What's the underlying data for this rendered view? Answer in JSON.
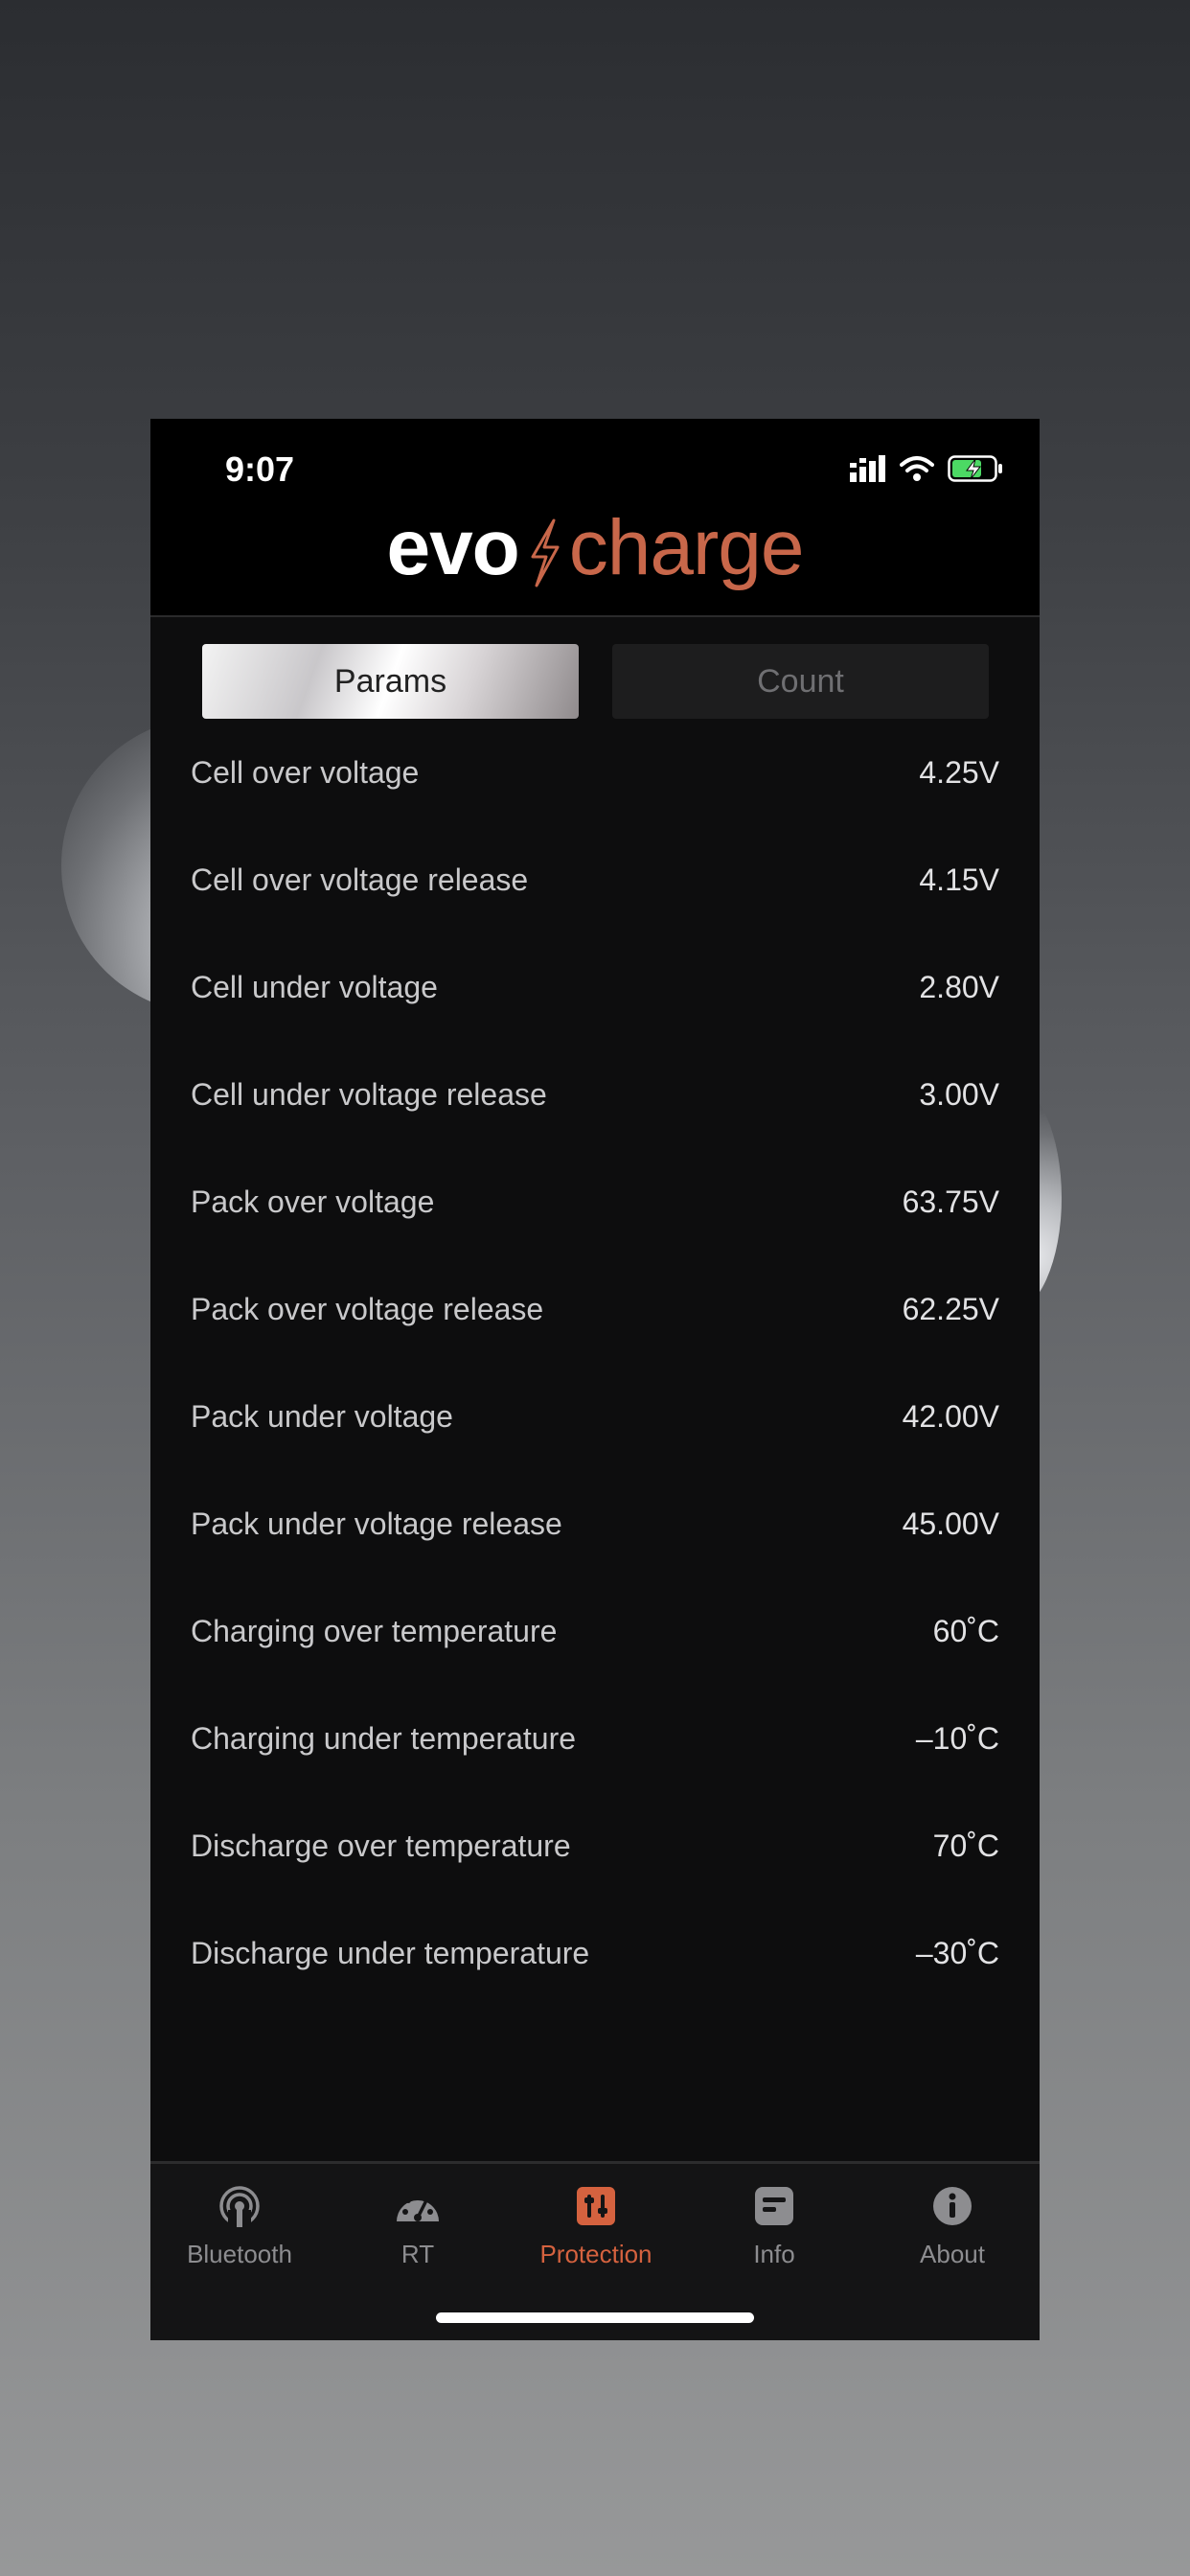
{
  "status": {
    "time": "9:07"
  },
  "brand": {
    "evo": "evo",
    "charge": "charge",
    "accent": "#c8674a"
  },
  "segments": {
    "params_label": "Params",
    "count_label": "Count",
    "active": "Params"
  },
  "params": [
    {
      "label": "Cell over voltage",
      "value": "4.25V"
    },
    {
      "label": "Cell over voltage release",
      "value": "4.15V"
    },
    {
      "label": "Cell under voltage",
      "value": "2.80V"
    },
    {
      "label": "Cell under voltage release",
      "value": "3.00V"
    },
    {
      "label": "Pack over voltage",
      "value": "63.75V"
    },
    {
      "label": "Pack over voltage release",
      "value": "62.25V"
    },
    {
      "label": "Pack under voltage",
      "value": "42.00V"
    },
    {
      "label": "Pack under voltage release",
      "value": "45.00V"
    },
    {
      "label": "Charging over temperature",
      "value": "60˚C"
    },
    {
      "label": "Charging under temperature",
      "value": "–10˚C"
    },
    {
      "label": "Discharge over temperature",
      "value": "70˚C"
    },
    {
      "label": "Discharge under temperature",
      "value": "–30˚C"
    }
  ],
  "tabs": [
    {
      "label": "Bluetooth",
      "icon": "bluetooth-signal-icon"
    },
    {
      "label": "RT",
      "icon": "gauge-icon"
    },
    {
      "label": "Protection",
      "icon": "protection-sliders-icon",
      "active": true
    },
    {
      "label": "Info",
      "icon": "info-card-icon"
    },
    {
      "label": "About",
      "icon": "about-info-icon"
    }
  ],
  "colors": {
    "active_tab": "#d5623f",
    "inactive_tab": "#8d8d90"
  }
}
